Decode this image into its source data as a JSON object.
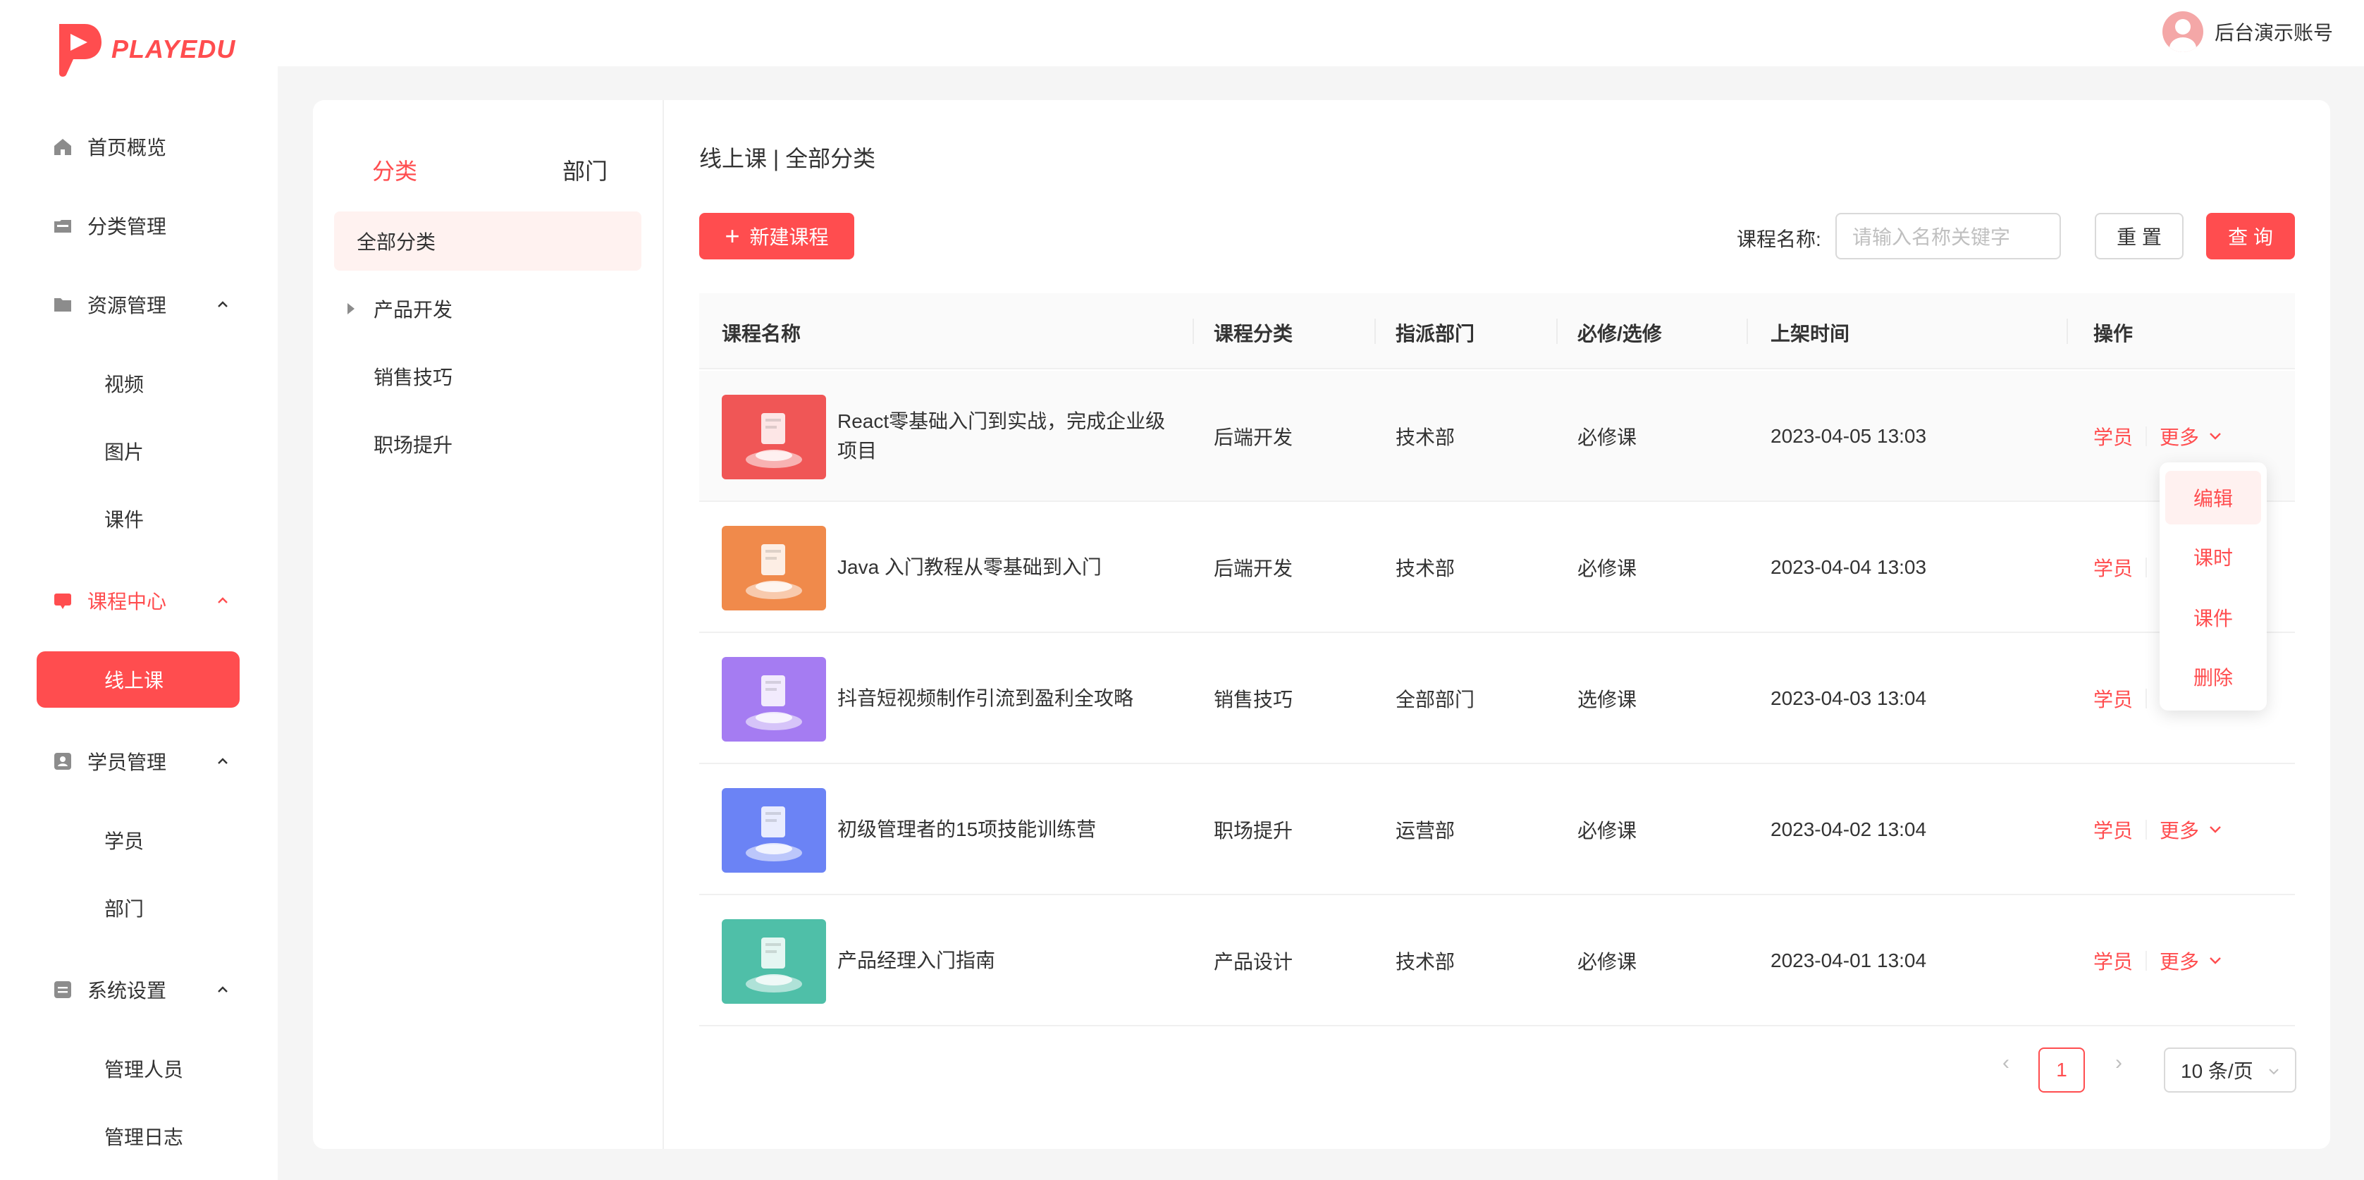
{
  "app": {
    "logo_text": "PLAYEDU",
    "brand_color": "#ff4d4f"
  },
  "user": {
    "name": "后台演示账号"
  },
  "sidebar": {
    "items": [
      {
        "label": "首页概览",
        "icon": "home-icon"
      },
      {
        "label": "分类管理",
        "icon": "folder-open-icon"
      },
      {
        "label": "资源管理",
        "icon": "folder-icon",
        "sub": [
          "视频",
          "图片",
          "课件"
        ]
      },
      {
        "label": "课程中心",
        "icon": "course-icon",
        "active": true,
        "sub": [
          "线上课"
        ]
      },
      {
        "label": "学员管理",
        "icon": "user-card-icon",
        "sub": [
          "学员",
          "部门"
        ]
      },
      {
        "label": "系统设置",
        "icon": "settings-icon",
        "sub": [
          "管理人员",
          "管理日志"
        ]
      }
    ]
  },
  "categories": {
    "tabs": [
      "分类",
      "部门"
    ],
    "active_tab": "分类",
    "tree": [
      "全部分类",
      "产品开发",
      "销售技巧",
      "职场提升"
    ]
  },
  "main": {
    "breadcrumb": "线上课 | 全部分类",
    "new_button": "新建课程",
    "filter_label": "课程名称:",
    "filter_placeholder": "请输入名称关键字",
    "reset_button": "重 置",
    "query_button": "查 询"
  },
  "table": {
    "columns": [
      "课程名称",
      "课程分类",
      "指派部门",
      "必修/选修",
      "上架时间",
      "操作"
    ],
    "rows": [
      {
        "name_line1": "React零基础入门到实战，完成企业级",
        "name_line2": "项目",
        "category": "后端开发",
        "dept": "技术部",
        "type": "必修课",
        "time": "2023-04-05 13:03",
        "thumb": "#f05656"
      },
      {
        "name_line1": "Java 入门教程从零基础到入门",
        "name_line2": "",
        "category": "后端开发",
        "dept": "技术部",
        "type": "必修课",
        "time": "2023-04-04 13:03",
        "thumb": "#f08a4b"
      },
      {
        "name_line1": "抖音短视频制作引流到盈利全攻略",
        "name_line2": "",
        "category": "销售技巧",
        "dept": "全部部门",
        "type": "选修课",
        "time": "2023-04-03 13:04",
        "thumb": "#a57cf2"
      },
      {
        "name_line1": "初级管理者的15项技能训练营",
        "name_line2": "",
        "category": "职场提升",
        "dept": "运营部",
        "type": "必修课",
        "time": "2023-04-02 13:04",
        "thumb": "#6b83f5"
      },
      {
        "name_line1": "产品经理入门指南",
        "name_line2": "",
        "category": "产品设计",
        "dept": "技术部",
        "type": "必修课",
        "time": "2023-04-01 13:04",
        "thumb": "#4fbfa8"
      }
    ],
    "op_students": "学员",
    "op_more": "更多"
  },
  "dropdown": {
    "items": [
      "编辑",
      "课时",
      "课件",
      "删除"
    ]
  },
  "pagination": {
    "current": "1",
    "page_size": "10 条/页"
  }
}
